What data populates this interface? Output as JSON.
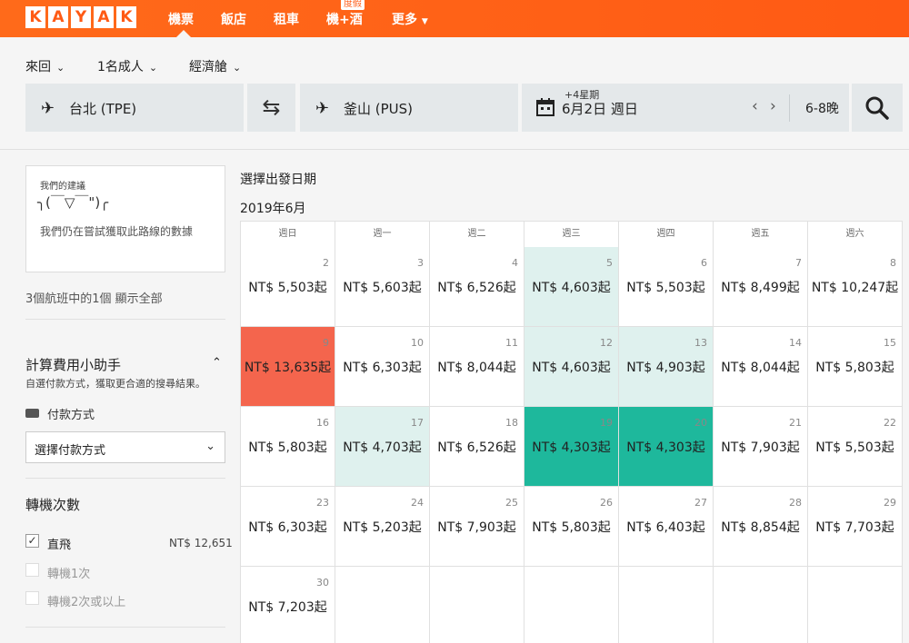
{
  "nav": {
    "logo_letters": [
      "K",
      "A",
      "Y",
      "A",
      "K"
    ],
    "flights": "機票",
    "hotels": "飯店",
    "cars": "租車",
    "packages": "機+酒",
    "packages_badge": "度假",
    "more": "更多"
  },
  "search": {
    "trip_type": "來回",
    "travelers": "1名成人",
    "cabin": "經濟艙",
    "origin": "台北 (TPE)",
    "destination": "釜山 (PUS)",
    "date_sub": "+4星期",
    "date": "6月2日 週日",
    "nights": "6-8晚"
  },
  "sidebar": {
    "tip_title": "我們的建議",
    "tip_face": "╮(￣▽￣\")╭",
    "tip_message": "我們仍在嘗試獲取此路線的數據",
    "show_all": "3個航班中的1個 顯示全部",
    "fee_title": "計算費用小助手",
    "fee_desc": "自選付款方式，獲取更合適的搜尋結果。",
    "payment_label": "付款方式",
    "payment_select": "選擇付款方式",
    "stops_title": "轉機次數",
    "stops": [
      {
        "label": "直飛",
        "checked": true,
        "price": "NT$ 12,651"
      },
      {
        "label": "轉機1次",
        "checked": false
      },
      {
        "label": "轉機2次或以上",
        "checked": false
      }
    ]
  },
  "calendar": {
    "heading": "選擇出發日期",
    "month": "2019年6月",
    "weekdays": [
      "週日",
      "週一",
      "週二",
      "週三",
      "週四",
      "週五",
      "週六"
    ],
    "weeks": [
      [
        {
          "day": "2",
          "price": "NT$ 5,503起",
          "style": "none"
        },
        {
          "day": "3",
          "price": "NT$ 5,603起",
          "style": "none"
        },
        {
          "day": "4",
          "price": "NT$ 6,526起",
          "style": "none"
        },
        {
          "day": "5",
          "price": "NT$ 4,603起",
          "style": "light"
        },
        {
          "day": "6",
          "price": "NT$ 5,503起",
          "style": "none"
        },
        {
          "day": "7",
          "price": "NT$ 8,499起",
          "style": "none"
        },
        {
          "day": "8",
          "price": "NT$ 10,247起",
          "style": "none"
        }
      ],
      [
        {
          "day": "9",
          "price": "NT$ 13,635起",
          "style": "red"
        },
        {
          "day": "10",
          "price": "NT$ 6,303起",
          "style": "none"
        },
        {
          "day": "11",
          "price": "NT$ 8,044起",
          "style": "none"
        },
        {
          "day": "12",
          "price": "NT$ 4,603起",
          "style": "light"
        },
        {
          "day": "13",
          "price": "NT$ 4,903起",
          "style": "light"
        },
        {
          "day": "14",
          "price": "NT$ 8,044起",
          "style": "none"
        },
        {
          "day": "15",
          "price": "NT$ 5,803起",
          "style": "none"
        }
      ],
      [
        {
          "day": "16",
          "price": "NT$ 5,803起",
          "style": "none"
        },
        {
          "day": "17",
          "price": "NT$ 4,703起",
          "style": "light"
        },
        {
          "day": "18",
          "price": "NT$ 6,526起",
          "style": "none"
        },
        {
          "day": "19",
          "price": "NT$ 4,303起",
          "style": "green"
        },
        {
          "day": "20",
          "price": "NT$ 4,303起",
          "style": "green"
        },
        {
          "day": "21",
          "price": "NT$ 7,903起",
          "style": "none"
        },
        {
          "day": "22",
          "price": "NT$ 5,503起",
          "style": "none"
        }
      ],
      [
        {
          "day": "23",
          "price": "NT$ 6,303起",
          "style": "none"
        },
        {
          "day": "24",
          "price": "NT$ 5,203起",
          "style": "none"
        },
        {
          "day": "25",
          "price": "NT$ 7,903起",
          "style": "none"
        },
        {
          "day": "26",
          "price": "NT$ 5,803起",
          "style": "none"
        },
        {
          "day": "27",
          "price": "NT$ 6,403起",
          "style": "none"
        },
        {
          "day": "28",
          "price": "NT$ 8,854起",
          "style": "none"
        },
        {
          "day": "29",
          "price": "NT$ 7,703起",
          "style": "none"
        }
      ],
      [
        {
          "day": "30",
          "price": "NT$ 7,203起",
          "style": "none"
        },
        {
          "day": "",
          "price": "",
          "style": "none"
        },
        {
          "day": "",
          "price": "",
          "style": "none"
        },
        {
          "day": "",
          "price": "",
          "style": "none"
        },
        {
          "day": "",
          "price": "",
          "style": "none"
        },
        {
          "day": "",
          "price": "",
          "style": "none"
        },
        {
          "day": "",
          "price": "",
          "style": "none"
        }
      ]
    ]
  },
  "colors": {
    "brand": "#ff5a14",
    "cheapest": "#1eb89c",
    "cheap": "#dff1ee",
    "expensive": "#f4654d"
  }
}
